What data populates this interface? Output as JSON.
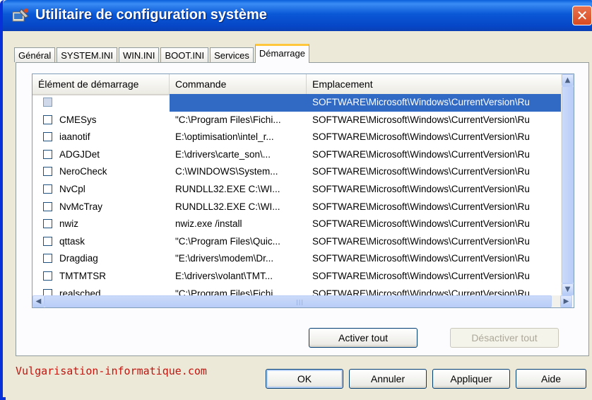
{
  "window": {
    "title": "Utilitaire de configuration système",
    "close_label": "✕"
  },
  "tabs": [
    {
      "label": "Général",
      "active": false
    },
    {
      "label": "SYSTEM.INI",
      "active": false
    },
    {
      "label": "WIN.INI",
      "active": false
    },
    {
      "label": "BOOT.INI",
      "active": false
    },
    {
      "label": "Services",
      "active": false
    },
    {
      "label": "Démarrage",
      "active": true
    }
  ],
  "list": {
    "columns": [
      "Élément de démarrage",
      "Commande",
      "Emplacement"
    ],
    "rows": [
      {
        "name": "",
        "command": "",
        "location": "SOFTWARE\\Microsoft\\Windows\\CurrentVersion\\Ru",
        "selected": true
      },
      {
        "name": "CMESys",
        "command": "\"C:\\Program Files\\Fichi...",
        "location": "SOFTWARE\\Microsoft\\Windows\\CurrentVersion\\Ru"
      },
      {
        "name": "iaanotif",
        "command": "E:\\optimisation\\intel_r...",
        "location": "SOFTWARE\\Microsoft\\Windows\\CurrentVersion\\Ru"
      },
      {
        "name": "ADGJDet",
        "command": "E:\\drivers\\carte_son\\...",
        "location": "SOFTWARE\\Microsoft\\Windows\\CurrentVersion\\Ru"
      },
      {
        "name": "NeroCheck",
        "command": "C:\\WINDOWS\\System...",
        "location": "SOFTWARE\\Microsoft\\Windows\\CurrentVersion\\Ru"
      },
      {
        "name": "NvCpl",
        "command": "RUNDLL32.EXE C:\\WI...",
        "location": "SOFTWARE\\Microsoft\\Windows\\CurrentVersion\\Ru"
      },
      {
        "name": "NvMcTray",
        "command": "RUNDLL32.EXE C:\\WI...",
        "location": "SOFTWARE\\Microsoft\\Windows\\CurrentVersion\\Ru"
      },
      {
        "name": "nwiz",
        "command": "nwiz.exe /install",
        "location": "SOFTWARE\\Microsoft\\Windows\\CurrentVersion\\Ru"
      },
      {
        "name": "qttask",
        "command": "\"C:\\Program Files\\Quic...",
        "location": "SOFTWARE\\Microsoft\\Windows\\CurrentVersion\\Ru"
      },
      {
        "name": "Dragdiag",
        "command": "\"E:\\drivers\\modem\\Dr...",
        "location": "SOFTWARE\\Microsoft\\Windows\\CurrentVersion\\Ru"
      },
      {
        "name": "TMTMTSR",
        "command": "E:\\drivers\\volant\\TMT...",
        "location": "SOFTWARE\\Microsoft\\Windows\\CurrentVersion\\Ru"
      },
      {
        "name": "realsched",
        "command": "\"C:\\Program Files\\Fichi...",
        "location": "SOFTWARE\\Microsoft\\Windows\\CurrentVersion\\Ru"
      }
    ]
  },
  "buttons": {
    "enable_all": "Activer tout",
    "disable_all": "Désactiver tout",
    "ok": "OK",
    "cancel": "Annuler",
    "apply": "Appliquer",
    "help": "Aide"
  },
  "watermark": "Vulgarisation-informatique.com",
  "colors": {
    "titlebar": "#0a58d6",
    "selection": "#316ac5",
    "active_tab_accent": "#ffc83c",
    "watermark": "#c4140e"
  }
}
